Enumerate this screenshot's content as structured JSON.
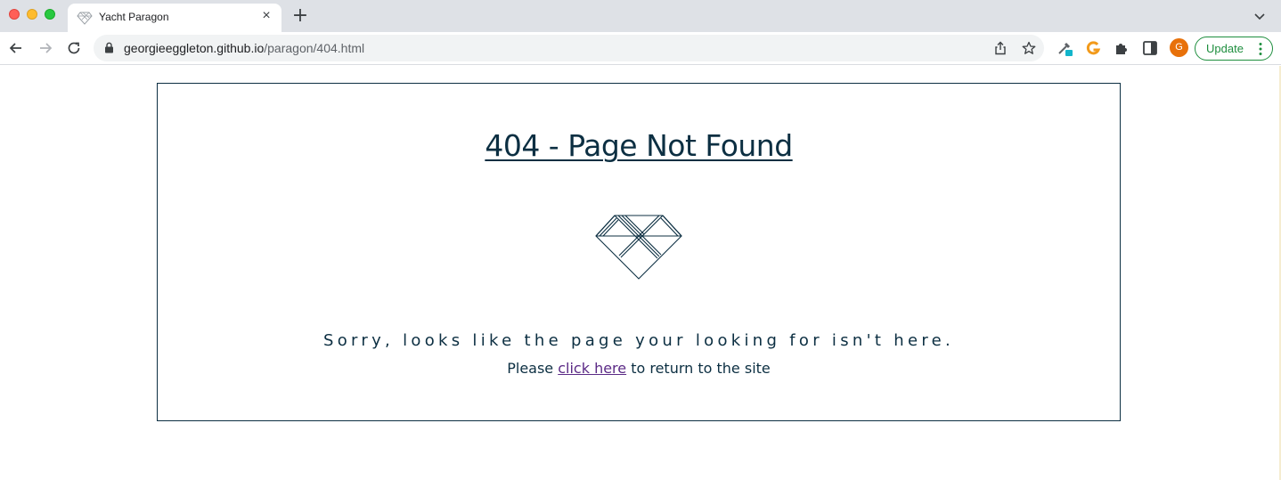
{
  "browser": {
    "tab": {
      "title": "Yacht Paragon",
      "favicon": "diamond-icon",
      "close": "×"
    },
    "new_tab": "+",
    "url": {
      "host": "georgieeggleton.github.io",
      "path": "/paragon/404.html"
    },
    "profile_initial": "G",
    "update_label": "Update"
  },
  "page": {
    "heading": "404 - Page Not Found",
    "message": "Sorry, looks like the page your looking for isn't here.",
    "return_prefix": "Please ",
    "return_link": "click here",
    "return_suffix": " to return to the site"
  },
  "colors": {
    "primary": "#0c2f42",
    "visited_link": "#5b2a86",
    "update_green": "#1e8e3e",
    "avatar": "#e8710a"
  }
}
